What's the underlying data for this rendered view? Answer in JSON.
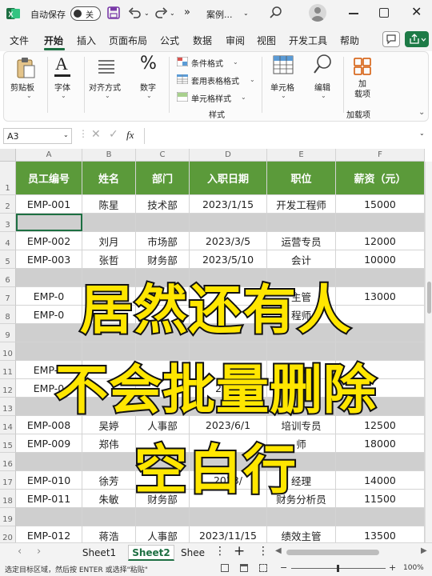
{
  "titlebar": {
    "autosave_label": "自动保存",
    "autosave_state": "关",
    "filename": "案例...",
    "chevron": "»"
  },
  "menu": {
    "items": [
      "文件",
      "开始",
      "插入",
      "页面布局",
      "公式",
      "数据",
      "审阅",
      "视图",
      "开发工具",
      "帮助"
    ],
    "active": "开始"
  },
  "ribbon": {
    "paste": "剪贴板",
    "font": "字体",
    "align": "对齐方式",
    "number": "数字",
    "cond_format": "条件格式",
    "table_format": "套用表格格式",
    "cell_style": "单元格样式",
    "styles_group": "样式",
    "cells": "单元格",
    "edit": "编辑",
    "addin": "加\n载项",
    "addins_group": "加载项"
  },
  "formula_bar": {
    "name_box": "A3",
    "fx": "fx",
    "formula": ""
  },
  "sheet": {
    "columns": [
      "A",
      "B",
      "C",
      "D",
      "E",
      "F"
    ],
    "header": [
      "员工编号",
      "姓名",
      "部门",
      "入职日期",
      "职位",
      "薪资（元）"
    ],
    "rows": [
      {
        "num": "1",
        "cells": [
          "员工编号",
          "姓名",
          "部门",
          "入职日期",
          "职位",
          "薪资（元）"
        ]
      },
      {
        "num": "2",
        "cells": [
          "EMP-001",
          "陈星",
          "技术部",
          "2023/1/15",
          "开发工程师",
          "15000"
        ]
      },
      {
        "num": "3",
        "cells": [
          "",
          "",
          "",
          "",
          "",
          ""
        ]
      },
      {
        "num": "4",
        "cells": [
          "EMP-002",
          "刘月",
          "市场部",
          "2023/3/5",
          "运营专员",
          "12000"
        ]
      },
      {
        "num": "5",
        "cells": [
          "EMP-003",
          "张哲",
          "财务部",
          "2023/5/10",
          "会计",
          "10000"
        ]
      },
      {
        "num": "6",
        "cells": [
          "",
          "",
          "",
          "",
          "",
          ""
        ]
      },
      {
        "num": "7",
        "cells": [
          "EMP-0",
          "",
          "",
          "",
          "主管",
          "13000"
        ]
      },
      {
        "num": "8",
        "cells": [
          "EMP-0",
          "",
          "",
          "",
          "程师",
          "",
          "10000"
        ]
      },
      {
        "num": "9",
        "cells": [
          "",
          "",
          "",
          "",
          "",
          ""
        ]
      },
      {
        "num": "10",
        "cells": [
          "",
          "",
          "",
          "",
          "",
          ""
        ]
      },
      {
        "num": "11",
        "cells": [
          "EMP-0",
          "",
          "",
          "",
          "市",
          "",
          "000"
        ]
      },
      {
        "num": "12",
        "cells": [
          "EMP-0",
          "",
          "",
          "2023",
          "",
          ""
        ]
      },
      {
        "num": "13",
        "cells": [
          "",
          "",
          "",
          "",
          "",
          ""
        ]
      },
      {
        "num": "14",
        "cells": [
          "EMP-008",
          "吴婷",
          "人事部",
          "2023/6/1",
          "培训专员",
          "12500"
        ]
      },
      {
        "num": "15",
        "cells": [
          "EMP-009",
          "郑伟",
          "",
          "",
          "师",
          "18000"
        ]
      },
      {
        "num": "16",
        "cells": [
          "",
          "",
          "",
          "",
          "",
          ""
        ]
      },
      {
        "num": "17",
        "cells": [
          "EMP-010",
          "徐芳",
          "",
          "2023/",
          "经理",
          "14000"
        ]
      },
      {
        "num": "18",
        "cells": [
          "EMP-011",
          "朱敏",
          "财务部",
          "",
          "财务分析员",
          "11500"
        ]
      },
      {
        "num": "19",
        "cells": [
          "",
          "",
          "",
          "",
          "",
          ""
        ]
      },
      {
        "num": "20",
        "cells": [
          "EMP-012",
          "蒋浩",
          "人事部",
          "2023/11/15",
          "绩效主管",
          "13500"
        ]
      }
    ]
  },
  "overlay": {
    "line1": "居然还有人",
    "line2": "不会批量删除",
    "line3": "空白行"
  },
  "tabs": {
    "sheets": [
      "Sheet1",
      "Sheet2",
      "Shee"
    ],
    "active": "Sheet2",
    "add": "+"
  },
  "status": {
    "text": "选定目标区域，然后按 ENTER 或选择\"粘贴\"",
    "zoom": "100%"
  },
  "colors": {
    "header_green": "#5b9a3a",
    "blank_row_grey": "#cfcfcf",
    "overlay_yellow": "#ffe600"
  }
}
